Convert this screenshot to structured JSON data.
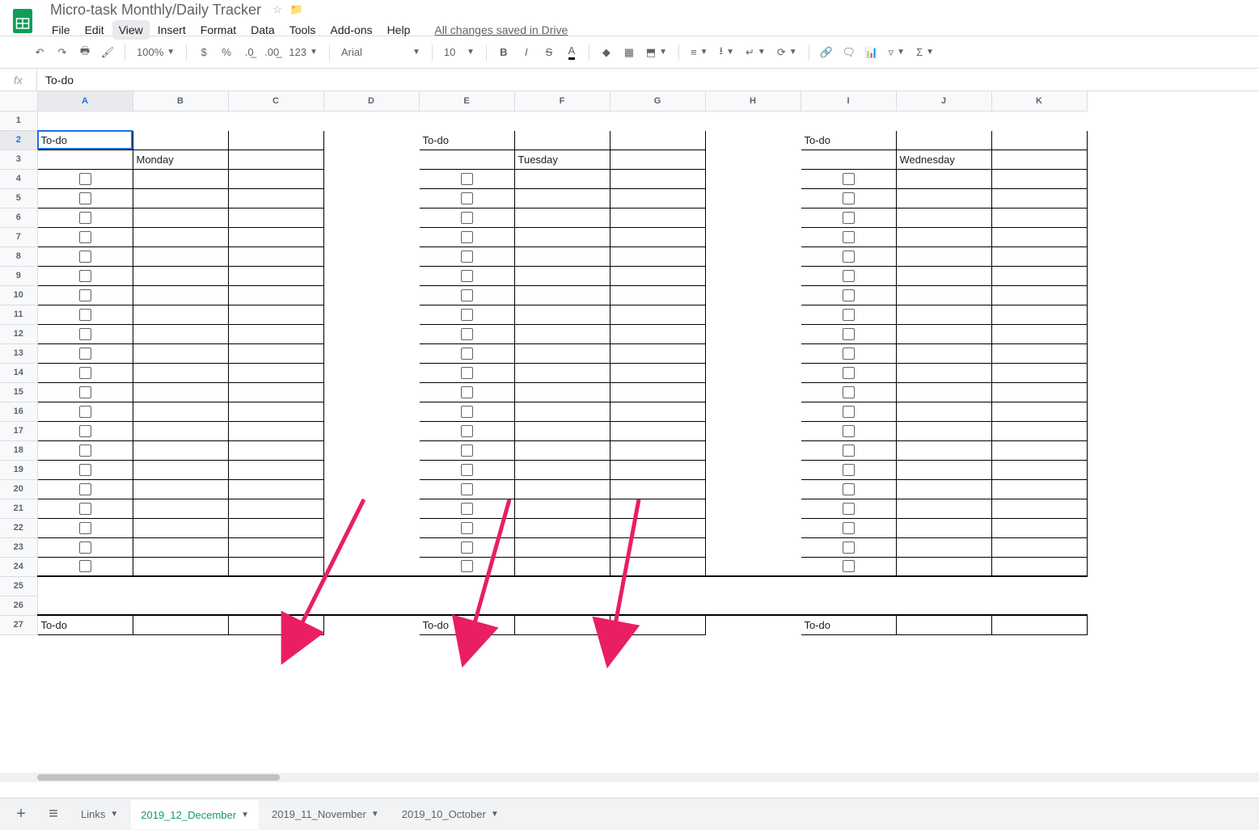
{
  "doc": {
    "title": "Micro-task Monthly/Daily Tracker",
    "save_status": "All changes saved in Drive"
  },
  "menu": [
    "File",
    "Edit",
    "View",
    "Insert",
    "Format",
    "Data",
    "Tools",
    "Add-ons",
    "Help"
  ],
  "toolbar": {
    "zoom": "100%",
    "number_format": "123",
    "font": "Arial",
    "font_size": "10"
  },
  "formula": {
    "value": "To-do"
  },
  "columns": [
    "A",
    "B",
    "C",
    "D",
    "E",
    "F",
    "G",
    "H",
    "I",
    "J",
    "K"
  ],
  "rows": [
    1,
    2,
    3,
    4,
    5,
    6,
    7,
    8,
    9,
    10,
    11,
    12,
    13,
    14,
    15,
    16,
    17,
    18,
    19,
    20,
    21,
    22,
    23,
    24,
    25,
    26,
    27
  ],
  "cells": {
    "todo": "To-do",
    "monday": "Monday",
    "tuesday": "Tuesday",
    "wednesday": "Wednesday"
  },
  "sheets": {
    "add": "+",
    "all": "≡",
    "tabs": [
      {
        "label": "Links",
        "active": false
      },
      {
        "label": "2019_12_December",
        "active": true
      },
      {
        "label": "2019_11_November",
        "active": false
      },
      {
        "label": "2019_10_October",
        "active": false
      }
    ]
  }
}
